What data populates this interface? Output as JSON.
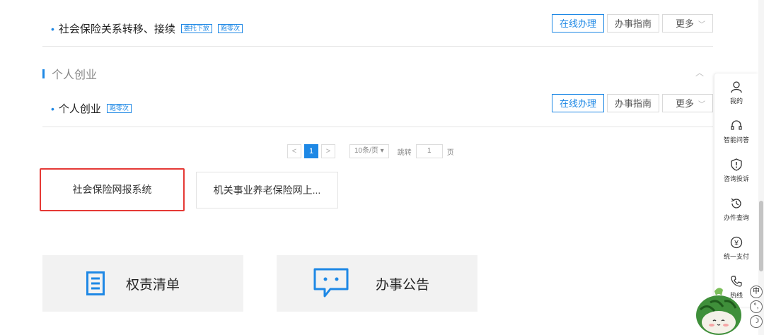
{
  "rows": [
    {
      "name": "社会保险关系转移、接续",
      "tags": [
        "委托下放",
        "跑零次"
      ],
      "btn_online": "在线办理",
      "btn_guide": "办事指南",
      "btn_more": "更多"
    },
    {
      "name": "个人创业",
      "tags": [
        "跑零次"
      ],
      "btn_online": "在线办理",
      "btn_guide": "办事指南",
      "btn_more": "更多"
    }
  ],
  "section": {
    "title": "个人创业"
  },
  "pager": {
    "prev": "<",
    "current": "1",
    "next": ">",
    "page_size": "10条/页",
    "jump_label": "跳转",
    "jump_value": "1",
    "page_unit": "页"
  },
  "systems": [
    {
      "label": "社会保险网报系统"
    },
    {
      "label": "机关事业养老保险网上..."
    }
  ],
  "cards": [
    {
      "label": "权责清单",
      "icon": "document-icon"
    },
    {
      "label": "办事公告",
      "icon": "chat-bubble-icon"
    }
  ],
  "sidebar": {
    "items": [
      {
        "label": "我的",
        "icon": "user-icon"
      },
      {
        "label": "智能问答",
        "icon": "headset-icon"
      },
      {
        "label": "咨询投诉",
        "icon": "shield-icon"
      },
      {
        "label": "办件查询",
        "icon": "history-icon"
      },
      {
        "label": "统一支付",
        "icon": "yen-icon"
      },
      {
        "label": "热线",
        "icon": "phone-icon"
      }
    ]
  },
  "ime": {
    "lang": "中",
    "punct": "°,",
    "moon": "☽"
  },
  "colors": {
    "accent": "#1e88e5",
    "selected_border": "#e53935",
    "card_bg": "#f2f2f2"
  }
}
